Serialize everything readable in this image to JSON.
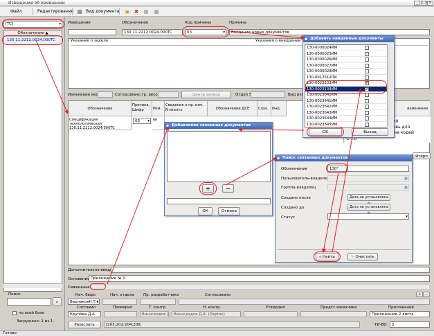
{
  "window": {
    "title": "Извещение об изменении"
  },
  "menu": {
    "file": "Файл",
    "edit": "Редактирование",
    "view": "Вид документа"
  },
  "left": {
    "filter_value": "[TC]",
    "col_header": "Обозначение",
    "selected_item": "130.11.2212.0024.000TC",
    "search_label": "Поиск:",
    "all_base_label": "по всей базе",
    "loaded_label": "Загружено: 1 из 1"
  },
  "header": {
    "notice_label": "Извещение",
    "designation_label": "Обозначение",
    "designation_value": "130.11.2212.0024.000TC",
    "reason_code_label": "Код причины",
    "reason_code_value": "03",
    "reason_label": "Причина",
    "reason_value": "Введение новых документов",
    "reserve_label": "Указание о заделе",
    "intro_label": "Указание о внедрении"
  },
  "mid": {
    "weight_change": "Изменение веса",
    "agreed_label": "Согласовано гр. весов",
    "check_btn": "Центр записи",
    "dept_label": "Отдел 5",
    "vid_label": "Вид изм"
  },
  "table": {
    "headers": [
      "Обозначение",
      "Причина, Шифр",
      "Изм.",
      "Сведения о пр. изм. N изъять",
      "Обозначение ДСЕ",
      "Случ.",
      "Инд."
    ],
    "row": {
      "designation": "Спецификация технологическая 130.11.2212.0024.000TC",
      "reason": "03",
      "izm": "вв"
    },
    "right_col_header": "изменения",
    "right_col_text": [
      "12.0024.00",
      "тство вновь для",
      "ументов на кодей"
    ],
    "right_col_small": "-1-1.0",
    "right_tab": "Итерп"
  },
  "dialog_found": {
    "title": "Добавить найденные документы",
    "items": [
      {
        "code": "130-0000024ИМ",
        "checked": false
      },
      {
        "code": "130-0000025ИМ",
        "checked": false
      },
      {
        "code": "130-0000026ИМ",
        "checked": false
      },
      {
        "code": "130-0000027ИМ",
        "checked": false
      },
      {
        "code": "130-0000028ИМ",
        "checked": false
      },
      {
        "code": "130-0012512ПИ",
        "checked": false
      },
      {
        "code": "130-0023133ИМ",
        "checked": true
      },
      {
        "code": "130-0023134ИМ",
        "checked": true
      },
      {
        "code": "130-0023640ИМ",
        "checked": false
      },
      {
        "code": "130-0023641ИМ",
        "checked": false
      },
      {
        "code": "130-0023642ИМ",
        "checked": false
      },
      {
        "code": "130-0023643ИМ",
        "checked": false
      },
      {
        "code": "130-0023644ИМ",
        "checked": false
      },
      {
        "code": "130-0023645ИМ",
        "checked": false
      }
    ],
    "ok": "ОК",
    "exit": "Выход"
  },
  "dialog_linked": {
    "title": "Добавление связанных документов",
    "ok": "ОК",
    "cancel": "Отмена",
    "plus": "+",
    "minus": "−"
  },
  "dialog_search": {
    "title": "Поиск связанных документов",
    "designation_label": "Обозначение",
    "designation_value": "130*",
    "user_owner_label": "Пользователь-владелец",
    "group_owner_label": "Группа-владелец",
    "created_after_label": "Создано после",
    "created_after_value": "Дата не установлена",
    "created_before_label": "Создано до",
    "created_before_value": "Дата не установлена",
    "status_label": "Статус",
    "find": "Найти",
    "clear": "Очистить"
  },
  "bottom": {
    "additional": "Дополнительно вводить",
    "naming_label": "Основание",
    "naming_value": "Приложение № 1",
    "link_label": "Связанные",
    "roles": {
      "boss_bureau": "Нач. бюро",
      "boss_dept": "Нач. отдела",
      "developer": "Пр. разработчика",
      "agreed": "Согласовано",
      "composed": "Составил",
      "checked": "Проверил",
      "tcontrol": "Т. контр.",
      "ncontrol": "Н. контр.",
      "approved": "Утвердил",
      "customer": "Предст.заказчика",
      "appendix": "Приложение"
    },
    "boss_bureau_value": "ВарнаковН.Т...",
    "composed_value": "Крупова Д.А.",
    "tcontrol_value": "Виноградов Д...",
    "ncontrol_value": "Виноградов Д.А. (Depton)",
    "appendix_value": "Приложение 2 листа",
    "send_btn": "Разослать",
    "send_value": "[203;202;204;208;",
    "tv_label": "ТИ-ВО",
    "tv_value": "2"
  },
  "status": {
    "text": "Готово"
  },
  "colors": {
    "accent": "#3f68b3",
    "highlight": "#e0251e",
    "selection": "#0a246a"
  }
}
